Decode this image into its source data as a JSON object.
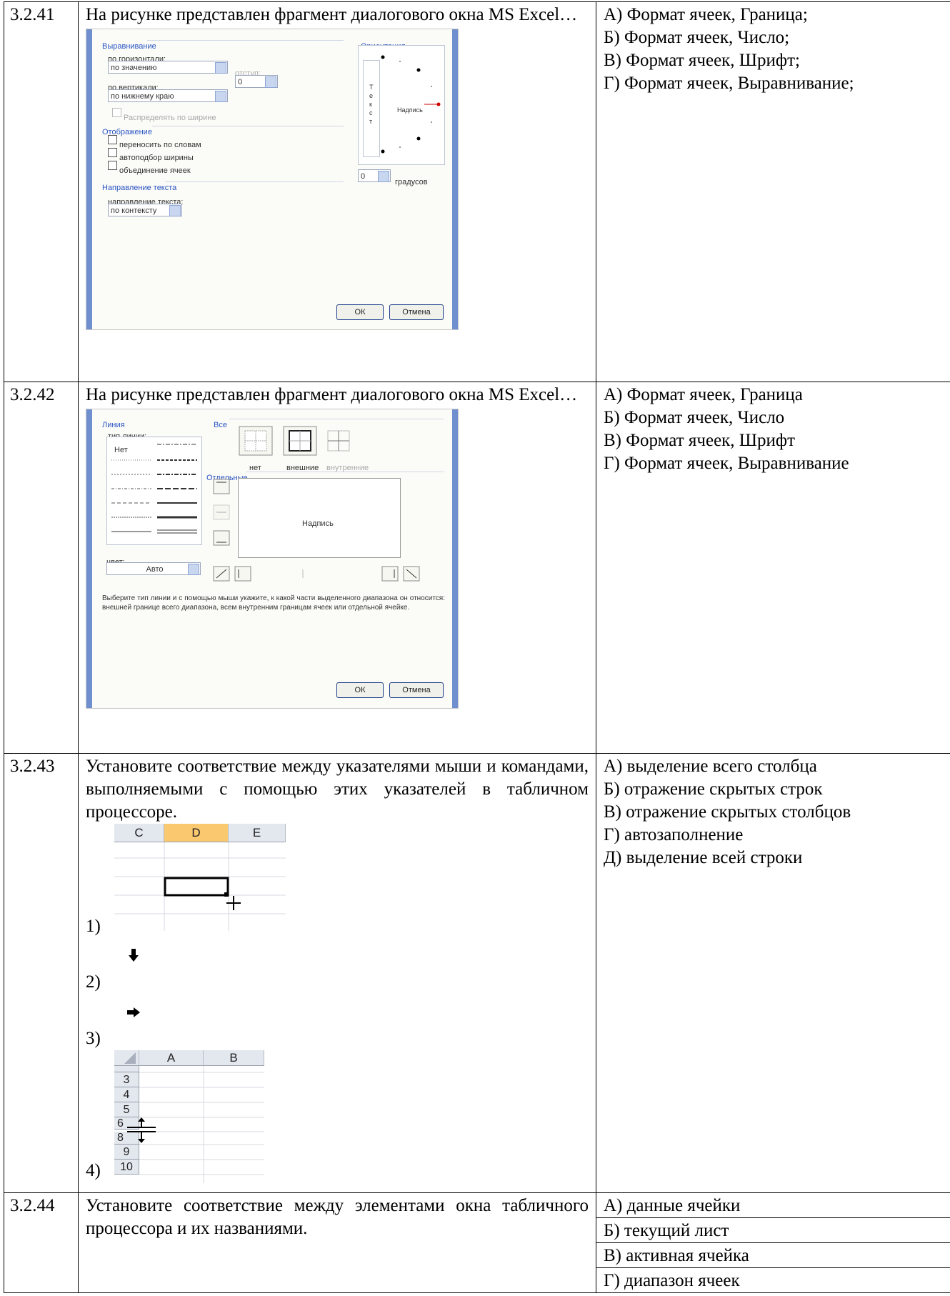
{
  "rows": [
    {
      "number": "3.2.41",
      "question": "На рисунке представлен фрагмент диалогового окна MS Excel…",
      "answers": [
        "А) Формат ячеек, Граница;",
        "Б) Формат ячеек, Число;",
        "В) Формат ячеек, Шрифт;",
        "Г) Формат ячеек, Выравнивание;"
      ],
      "dialog": {
        "alignment_group": "Выравнивание",
        "horizontal_label": "по горизонтали:",
        "horizontal_value": "по значению",
        "indent_label": "отступ:",
        "vertical_label": "по вертикали:",
        "vertical_value": "по нижнему краю",
        "indent_value": "0",
        "distribute_label": "Распределять по ширине",
        "display_group": "Отображение",
        "wrap_label": "переносить по словам",
        "autofit_label": "автоподбор ширины",
        "merge_label": "объединение ячеек",
        "direction_group": "Направление текста",
        "direction_label": "направление текста:",
        "direction_value": "по контексту",
        "orientation_group": "Ориентация",
        "vertical_text": "Т е к с т",
        "inscription": "Надпись",
        "degrees_value": "0",
        "degrees_label": "градусов",
        "ok": "ОК",
        "cancel": "Отмена"
      }
    },
    {
      "number": "3.2.42",
      "question": "На рисунке представлен фрагмент диалогового окна MS Excel…",
      "answers": [
        "А) Формат ячеек, Граница",
        "Б) Формат ячеек, Число",
        "В) Формат ячеек, Шрифт",
        "Г) Формат ячеек, Выравнивание"
      ],
      "dialog": {
        "line_group": "Линия",
        "line_type_label": "тип линии:",
        "none_label": "Нет",
        "all_group": "Все",
        "preset_none": "нет",
        "preset_outer": "внешние",
        "preset_inner": "внутренние",
        "separate_group": "Отдельные",
        "inscription": "Надпись",
        "color_label": "цвет:",
        "color_value": "Авто",
        "hint": "Выберите тип линии и с помощью мыши укажите, к какой части выделенного диапазона он относится: внешней границе всего диапазона, всем внутренним границам ячеек или отдельной ячейке.",
        "ok": "ОК",
        "cancel": "Отмена"
      }
    },
    {
      "number": "3.2.43",
      "question": "Установите соответствие между указателями мыши и командами, выполняемыми с помощью этих указателей в табличном процессоре.",
      "answers": [
        "А) выделение всего столбца",
        "Б) отражение скрытых строк",
        "В) отражение скрытых столбцов",
        "Г) автозаполнение",
        "Д) выделение всей строки"
      ],
      "items": [
        "1)",
        "2)",
        "3)",
        "4)"
      ],
      "sheet1": {
        "columns": [
          "C",
          "D",
          "E"
        ]
      },
      "sheet2": {
        "columns": [
          "A",
          "B"
        ],
        "rows": [
          "3",
          "4",
          "5",
          "6",
          "8",
          "9",
          "10"
        ]
      }
    },
    {
      "number": "3.2.44",
      "question": "Установите соответствие между элементами окна табличного процессора и их названиями.",
      "answers": [
        "А) данные ячейки",
        "Б) текущий лист",
        "В) активная ячейка",
        "Г) диапазон ячеек"
      ]
    }
  ]
}
